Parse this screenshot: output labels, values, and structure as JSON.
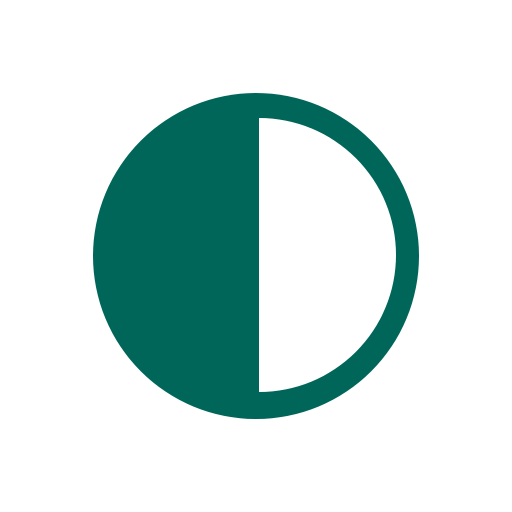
{
  "icon": {
    "name": "contrast-half-circle-icon",
    "colors": {
      "fill": "#00665A",
      "background": "#FFFFFF"
    }
  }
}
